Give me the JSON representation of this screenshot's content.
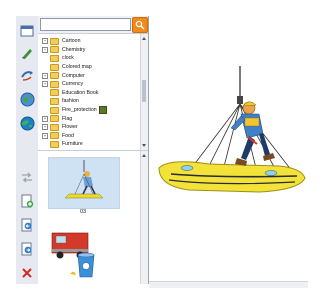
{
  "search": {
    "value": "",
    "placeholder": ""
  },
  "tree": {
    "items": [
      {
        "label": "Cartoon",
        "expandable": true
      },
      {
        "label": "Chemistry",
        "expandable": true
      },
      {
        "label": "clock",
        "expandable": false
      },
      {
        "label": "Colored map",
        "expandable": false
      },
      {
        "label": "Computer",
        "expandable": true
      },
      {
        "label": "Currency",
        "expandable": true
      },
      {
        "label": "Education Book",
        "expandable": false
      },
      {
        "label": "fashion",
        "expandable": false
      },
      {
        "label": "Fire_protection",
        "expandable": false,
        "badge": true
      },
      {
        "label": "Flag",
        "expandable": true
      },
      {
        "label": "Flower",
        "expandable": true
      },
      {
        "label": "Food",
        "expandable": true
      },
      {
        "label": "Furniture",
        "expandable": false
      }
    ]
  },
  "thumbnails": [
    {
      "label": "03",
      "icon": "rescue-worker-thumbnail"
    },
    {
      "label": "",
      "icon": "fire-truck-and-bucket-thumbnail"
    }
  ],
  "toolbar": {
    "icons": [
      "window-icon",
      "pen-icon",
      "arrows-icon",
      "globe-icon",
      "earth-icon",
      "swap-arrow-icon",
      "add-page-icon",
      "prev-page-icon",
      "next-page-icon",
      "delete-icon"
    ]
  },
  "colors": {
    "accent": "#f28a1a",
    "toolbar_bg": "#e6eaf0",
    "float_yellow": "#f2e23a"
  }
}
